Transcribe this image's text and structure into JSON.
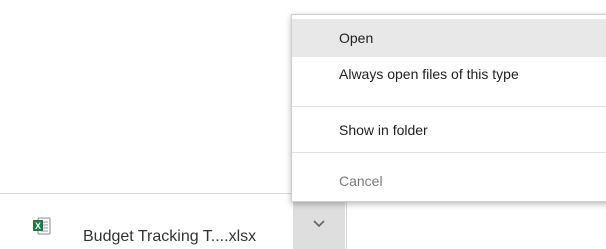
{
  "download_shelf": {
    "file_name": "Budget Tracking T....xlsx",
    "file_icon": "excel-file-icon",
    "chevron_icon": "chevron-down-icon",
    "colors": {
      "excel_green": "#1d7a45",
      "chevron_button_bg": "#dedede",
      "shelf_border": "#d4d4d4"
    }
  },
  "context_menu": {
    "items": [
      {
        "label": "Open",
        "state": "highlighted"
      },
      {
        "label": "Always open files of this type",
        "state": "normal"
      },
      {
        "label": "Show in folder",
        "state": "normal"
      },
      {
        "label": "Cancel",
        "state": "disabled"
      }
    ],
    "colors": {
      "highlight_bg": "#e8e8e8",
      "text": "#212121",
      "disabled_text": "#7a7a7a"
    }
  }
}
